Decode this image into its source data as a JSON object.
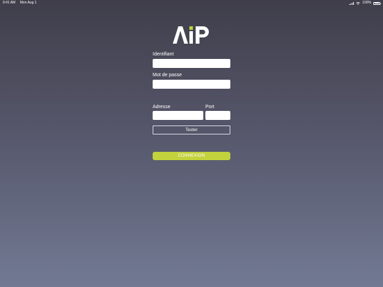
{
  "status_bar": {
    "time": "9:41 AM",
    "date": "Mon Aug 1",
    "battery": "100%"
  },
  "logo": {
    "text": "AIP",
    "accent_color": "#c1d23c"
  },
  "form": {
    "identifiant_label": "Identifiant",
    "identifiant_value": "",
    "password_label": "Mot de passe",
    "password_value": "",
    "address_label": "Adresse",
    "address_value": "",
    "port_label": "Port",
    "port_value": "",
    "test_button": "Tester",
    "connect_button": "CONNEXION"
  },
  "colors": {
    "background_top": "#3f3e4a",
    "background_bottom": "#727a93",
    "accent": "#c1d23c"
  }
}
